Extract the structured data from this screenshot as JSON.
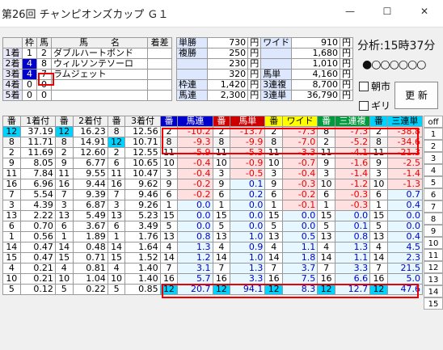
{
  "title": "第26回 チャンピオンズカップ Ｇ１",
  "result": {
    "head": [
      "",
      "枠",
      "馬",
      "馬",
      "名",
      "着差"
    ],
    "rows": [
      [
        "1着",
        "1",
        "2",
        "ダブルハートボンド",
        ""
      ],
      [
        "2着",
        "4",
        "8",
        "ウィルソンテソーロ",
        ""
      ],
      [
        "3着",
        "4",
        "7",
        "ラムジェット",
        ""
      ],
      [
        "4着",
        "0",
        "0",
        "",
        ""
      ],
      [
        "5着",
        "0",
        "0",
        "",
        ""
      ]
    ]
  },
  "payout": {
    "rows": [
      [
        "単勝",
        "730",
        "円",
        "ワイド",
        "910",
        "円"
      ],
      [
        "複勝",
        "250",
        "円",
        "",
        "1,680",
        "円"
      ],
      [
        "",
        "230",
        "円",
        "",
        "1,010",
        "円"
      ],
      [
        "",
        "320",
        "円",
        "馬単",
        "4,160",
        "円"
      ],
      [
        "枠連",
        "1,420",
        "円",
        "3連複",
        "8,700",
        "円"
      ],
      [
        "馬連",
        "2,300",
        "円",
        "3連単",
        "36,790",
        "円"
      ]
    ]
  },
  "side": {
    "time": "分析:15時37分",
    "radios": "●○○○○○○",
    "chk1": "朝市",
    "chk2": "ギリ",
    "refresh": "更 新"
  },
  "grid": {
    "headers": [
      "番",
      "1着付",
      "番",
      "2着付",
      "番",
      "3着付",
      "番",
      "馬連",
      "番",
      "馬単",
      "番",
      "ワイド",
      "番",
      "三連複",
      "番",
      "三連単"
    ],
    "rows": [
      [
        "12",
        "37.19",
        "12",
        "16.23",
        "8",
        "12.56",
        "2",
        "-10.2",
        "2",
        "-13.7",
        "2",
        "-7.3",
        "8",
        "-7.3",
        "2",
        "-38.8"
      ],
      [
        "8",
        "11.71",
        "8",
        "14.91",
        "12",
        "10.71",
        "8",
        "-9.3",
        "8",
        "-9.9",
        "8",
        "-7.0",
        "2",
        "-5.2",
        "8",
        "-34.6"
      ],
      [
        "2",
        "11.69",
        "2",
        "12.60",
        "2",
        "12.55",
        "11",
        "-5.9",
        "11",
        "-5.3",
        "11",
        "-3.3",
        "11",
        "-4.1",
        "11",
        "-21.3"
      ],
      [
        "9",
        "8.05",
        "9",
        "6.77",
        "6",
        "10.65",
        "10",
        "-0.4",
        "10",
        "-0.9",
        "10",
        "-0.7",
        "9",
        "-1.6",
        "9",
        "-2.5"
      ],
      [
        "11",
        "7.84",
        "11",
        "9.55",
        "11",
        "10.47",
        "3",
        "-0.4",
        "3",
        "-0.5",
        "3",
        "-0.4",
        "3",
        "-1.4",
        "3",
        "-1.4"
      ],
      [
        "16",
        "6.96",
        "16",
        "9.44",
        "16",
        "9.62",
        "9",
        "-0.2",
        "9",
        "0.1",
        "9",
        "-0.3",
        "10",
        "-1.2",
        "10",
        "-1.3"
      ],
      [
        "7",
        "5.54",
        "7",
        "9.39",
        "7",
        "9.46",
        "6",
        "-0.2",
        "6",
        "0.2",
        "6",
        "-0.2",
        "6",
        "-0.3",
        "6",
        "0.7"
      ],
      [
        "3",
        "4.39",
        "3",
        "6.87",
        "3",
        "9.26",
        "1",
        "0.0",
        "1",
        "0.0",
        "1",
        "-0.1",
        "1",
        "-0.3",
        "1",
        "0.4"
      ],
      [
        "13",
        "2.22",
        "13",
        "5.49",
        "13",
        "5.23",
        "15",
        "0.0",
        "15",
        "0.0",
        "15",
        "0.0",
        "15",
        "0.0",
        "15",
        "0.0"
      ],
      [
        "6",
        "0.70",
        "6",
        "3.67",
        "6",
        "3.49",
        "5",
        "0.0",
        "5",
        "0.0",
        "5",
        "0.0",
        "5",
        "0.1",
        "5",
        "0.0"
      ],
      [
        "1",
        "0.56",
        "1",
        "1.89",
        "1",
        "1.76",
        "13",
        "0.8",
        "13",
        "1.0",
        "13",
        "0.5",
        "13",
        "0.8",
        "13",
        "0.4"
      ],
      [
        "14",
        "0.47",
        "14",
        "0.48",
        "14",
        "1.64",
        "4",
        "1.3",
        "4",
        "0.9",
        "4",
        "1.1",
        "4",
        "1.3",
        "4",
        "4.5"
      ],
      [
        "15",
        "0.47",
        "15",
        "0.71",
        "15",
        "1.52",
        "14",
        "1.2",
        "14",
        "1.0",
        "14",
        "1.8",
        "14",
        "1.1",
        "14",
        "2.3"
      ],
      [
        "4",
        "0.21",
        "4",
        "0.81",
        "4",
        "1.40",
        "7",
        "3.1",
        "7",
        "1.3",
        "7",
        "3.7",
        "7",
        "3.3",
        "7",
        "21.5"
      ],
      [
        "10",
        "0.21",
        "10",
        "1.04",
        "10",
        "1.40",
        "16",
        "5.7",
        "16",
        "3.3",
        "16",
        "7.5",
        "16",
        "6.6",
        "16",
        "5.0"
      ],
      [
        "5",
        "0.12",
        "5",
        "0.22",
        "5",
        "0.85",
        "12",
        "20.7",
        "12",
        "94.1",
        "12",
        "8.3",
        "12",
        "12.7",
        "12",
        "47.6"
      ]
    ]
  },
  "offbtns": [
    "off",
    "1",
    "2",
    "3",
    "4",
    "5",
    "6",
    "7",
    "8",
    "9",
    "10",
    "11",
    "12",
    "13",
    "14",
    "15"
  ],
  "colors": {
    "waku1": "#ffffff",
    "waku2": "#000000",
    "waku3": "#e00000",
    "waku4": "#0000cc",
    "waku5": "#ffff00",
    "waku6": "#00a000",
    "waku7": "#ff8c00",
    "waku8": "#ff77cc"
  }
}
